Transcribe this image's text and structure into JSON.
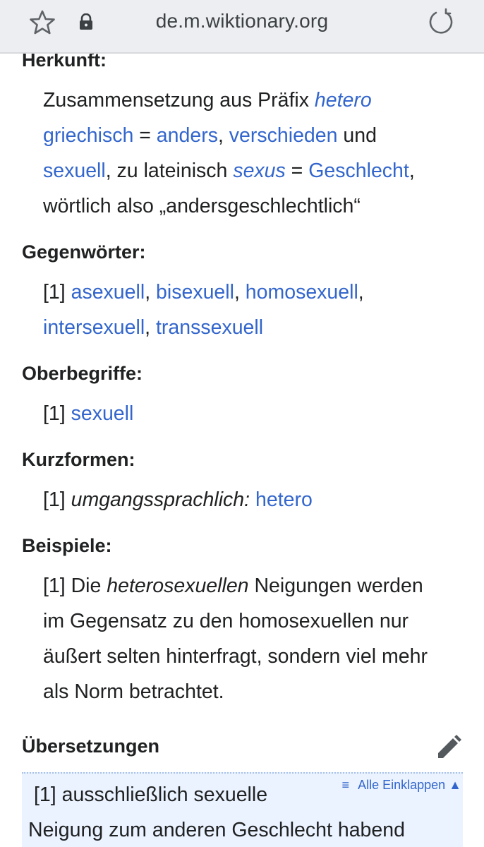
{
  "browser": {
    "url": "de.m.wiktionary.org"
  },
  "herkunft": {
    "heading": "Herkunft:",
    "line1": {
      "t1": "Zusammensetzung aus Präfix ",
      "l1": "hetero"
    },
    "line2": {
      "l1": "griechisch",
      "t1": " = ",
      "l2": "anders",
      "t2": ", ",
      "l3": "verschieden",
      "t3": " und"
    },
    "line3": {
      "l1": "sexuell",
      "t1": ", zu lateinisch ",
      "i1": "sexus",
      "t2": " = ",
      "l2": "Geschlecht",
      "t3": ","
    },
    "line4": "wörtlich also „andersgeschlechtlich“"
  },
  "gegenwoerter": {
    "heading": "Gegenwörter:",
    "marker": "[1] ",
    "items": [
      "asexuell",
      "bisexuell",
      "homosexuell",
      "intersexuell",
      "transsexuell"
    ],
    "sep": ", "
  },
  "oberbegriffe": {
    "heading": "Oberbegriffe:",
    "marker": "[1] ",
    "item": "sexuell"
  },
  "kurzformen": {
    "heading": "Kurzformen:",
    "marker": "[1] ",
    "qualifier": "umgangssprachlich:",
    "item": "hetero"
  },
  "beispiele": {
    "heading": "Beispiele:",
    "line1": {
      "marker": "[1] Die ",
      "i1": "heterosexuellen",
      "t1": " Neigungen werden"
    },
    "line2": "im Gegensatz zu den homosexuellen nur",
    "line3": "äußert selten hinterfragt, sondern viel mehr",
    "line4": "als Norm betrachtet."
  },
  "uebersetzungen": {
    "heading": "Übersetzungen",
    "collapse_icon": "≡",
    "collapse_label": "Alle Einklappen",
    "collapse_arrow": "▲",
    "line1": "[1] ausschließlich sexuelle",
    "line2": "Neigung zum anderen Geschlecht habend"
  },
  "icons": {
    "star": "star-outline-icon",
    "lock": "lock-icon",
    "reload": "reload-icon",
    "edit": "pencil-edit-icon"
  },
  "colors": {
    "link": "#3366cc",
    "text": "#202122",
    "toolbar": "#eceef1",
    "translation_box": "#eaf3ff"
  }
}
